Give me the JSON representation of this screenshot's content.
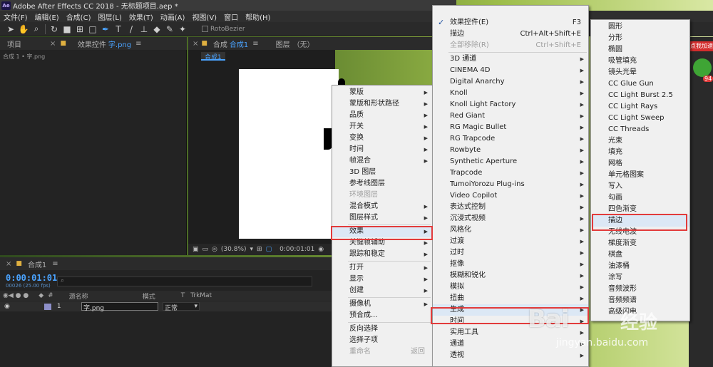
{
  "window": {
    "title": "Adobe After Effects CC 2018 - 无标题项目.aep *",
    "logo": "Ae"
  },
  "menubar": [
    "文件(F)",
    "编辑(E)",
    "合成(C)",
    "图层(L)",
    "效果(T)",
    "动画(A)",
    "视图(V)",
    "窗口",
    "帮助(H)"
  ],
  "toolbar": {
    "roto_label": "RotoBezier"
  },
  "left_panel": {
    "tab_project": "项目",
    "tab_effects": "效果控件",
    "tab_effects_target": "字.png",
    "subtitle": "合成 1 • 字.png"
  },
  "comp_panel": {
    "tab_comp": "合成",
    "tab_comp_name": "合成1",
    "tab_layer": "图层",
    "tab_layer_value": "（无）",
    "subtab": "合成1",
    "zoom": "(30.8%)",
    "timecode": "0:00:01:01"
  },
  "timeline": {
    "tab": "合成1",
    "time": "0:00:01:01",
    "fps": "00026 (25.00 fps)",
    "search_placeholder": "",
    "col_source": "源名称",
    "col_mode": "模式",
    "col_t": "T",
    "col_trkmat": "TrkMat",
    "row_index": "1",
    "row_name": "字.png",
    "row_mode": "正常"
  },
  "context_menu": {
    "items": [
      {
        "label": "蒙版",
        "sub": true
      },
      {
        "label": "蒙版和形状路径",
        "sub": true
      },
      {
        "label": "品质",
        "sub": true
      },
      {
        "label": "开关",
        "sub": true
      },
      {
        "label": "变换",
        "sub": true
      },
      {
        "label": "时间",
        "sub": true
      },
      {
        "label": "帧混合",
        "sub": true
      },
      {
        "label": "3D 图层",
        "sub": false
      },
      {
        "label": "参考线图层",
        "sub": false
      },
      {
        "label": "环境图层",
        "sub": false,
        "disabled": true
      },
      {
        "label": "混合模式",
        "sub": true
      },
      {
        "label": "图层样式",
        "sub": true
      },
      {
        "sep": true
      },
      {
        "label": "效果",
        "sub": true,
        "highlight": true
      },
      {
        "label": "关键帧辅助",
        "sub": true
      },
      {
        "label": "跟踪和稳定",
        "sub": true
      },
      {
        "sep": true
      },
      {
        "label": "打开",
        "sub": true
      },
      {
        "label": "显示",
        "sub": true
      },
      {
        "label": "创建",
        "sub": true
      },
      {
        "sep": true
      },
      {
        "label": "摄像机",
        "sub": true
      },
      {
        "label": "预合成...",
        "sub": false
      },
      {
        "sep": true
      },
      {
        "label": "反向选择",
        "sub": false
      },
      {
        "label": "选择子项",
        "sub": false
      },
      {
        "label": "重命名",
        "sub": false,
        "disabled": true,
        "shortcut": "返回"
      }
    ]
  },
  "effects_menu": {
    "items": [
      {
        "label": "效果控件(E)",
        "shortcut": "F3",
        "checked": true
      },
      {
        "label": "描边",
        "shortcut": "Ctrl+Alt+Shift+E"
      },
      {
        "label": "全部移除(R)",
        "shortcut": "Ctrl+Shift+E",
        "disabled": true
      },
      {
        "sep": true
      },
      {
        "label": "3D 通道",
        "sub": true
      },
      {
        "label": "CINEMA 4D",
        "sub": true
      },
      {
        "label": "Digital Anarchy",
        "sub": true
      },
      {
        "label": "Knoll",
        "sub": true
      },
      {
        "label": "Knoll Light Factory",
        "sub": true
      },
      {
        "label": "Red Giant",
        "sub": true
      },
      {
        "label": "RG Magic Bullet",
        "sub": true
      },
      {
        "label": "RG Trapcode",
        "sub": true
      },
      {
        "label": "Rowbyte",
        "sub": true
      },
      {
        "label": "Synthetic Aperture",
        "sub": true
      },
      {
        "label": "Trapcode",
        "sub": true
      },
      {
        "label": "TumoiYorozu Plug-ins",
        "sub": true
      },
      {
        "label": "Video Copilot",
        "sub": true
      },
      {
        "label": "表达式控制",
        "sub": true
      },
      {
        "label": "沉浸式视频",
        "sub": true
      },
      {
        "label": "风格化",
        "sub": true
      },
      {
        "label": "过渡",
        "sub": true
      },
      {
        "label": "过时",
        "sub": true
      },
      {
        "label": "抠像",
        "sub": true
      },
      {
        "label": "模糊和锐化",
        "sub": true
      },
      {
        "label": "模拟",
        "sub": true
      },
      {
        "label": "扭曲",
        "sub": true
      },
      {
        "label": "生成",
        "sub": true,
        "highlight": true
      },
      {
        "label": "时间",
        "sub": true
      },
      {
        "label": "实用工具",
        "sub": true
      },
      {
        "label": "通道",
        "sub": true
      },
      {
        "label": "透视",
        "sub": true
      }
    ]
  },
  "generate_menu": {
    "items": [
      {
        "label": "圆形"
      },
      {
        "label": "分形"
      },
      {
        "label": "椭圆"
      },
      {
        "label": "吸管填充"
      },
      {
        "label": "镜头光晕"
      },
      {
        "label": "CC Glue Gun"
      },
      {
        "label": "CC Light Burst 2.5"
      },
      {
        "label": "CC Light Rays"
      },
      {
        "label": "CC Light Sweep"
      },
      {
        "label": "CC Threads"
      },
      {
        "label": "光束"
      },
      {
        "label": "填充"
      },
      {
        "label": "网格"
      },
      {
        "label": "单元格图案"
      },
      {
        "label": "写入"
      },
      {
        "label": "勾画"
      },
      {
        "label": "四色渐变"
      },
      {
        "label": "描边",
        "highlight": true
      },
      {
        "label": "无线电波"
      },
      {
        "label": "梯度渐变"
      },
      {
        "label": "棋盘"
      },
      {
        "label": "油漆桶"
      },
      {
        "label": "涂写"
      },
      {
        "label": "音频波形"
      },
      {
        "label": "音频频谱"
      },
      {
        "label": "高级闪电"
      }
    ]
  },
  "watermark": {
    "brand": "Bai",
    "brand_cn": "经验",
    "url": "jingyan.baidu.com"
  },
  "ad": {
    "badge": "点我加速",
    "count": "94"
  },
  "colors": {
    "highlight_box": "#e23b3b",
    "accent": "#4aa3ff",
    "menu_bg": "#f0f0f0"
  }
}
